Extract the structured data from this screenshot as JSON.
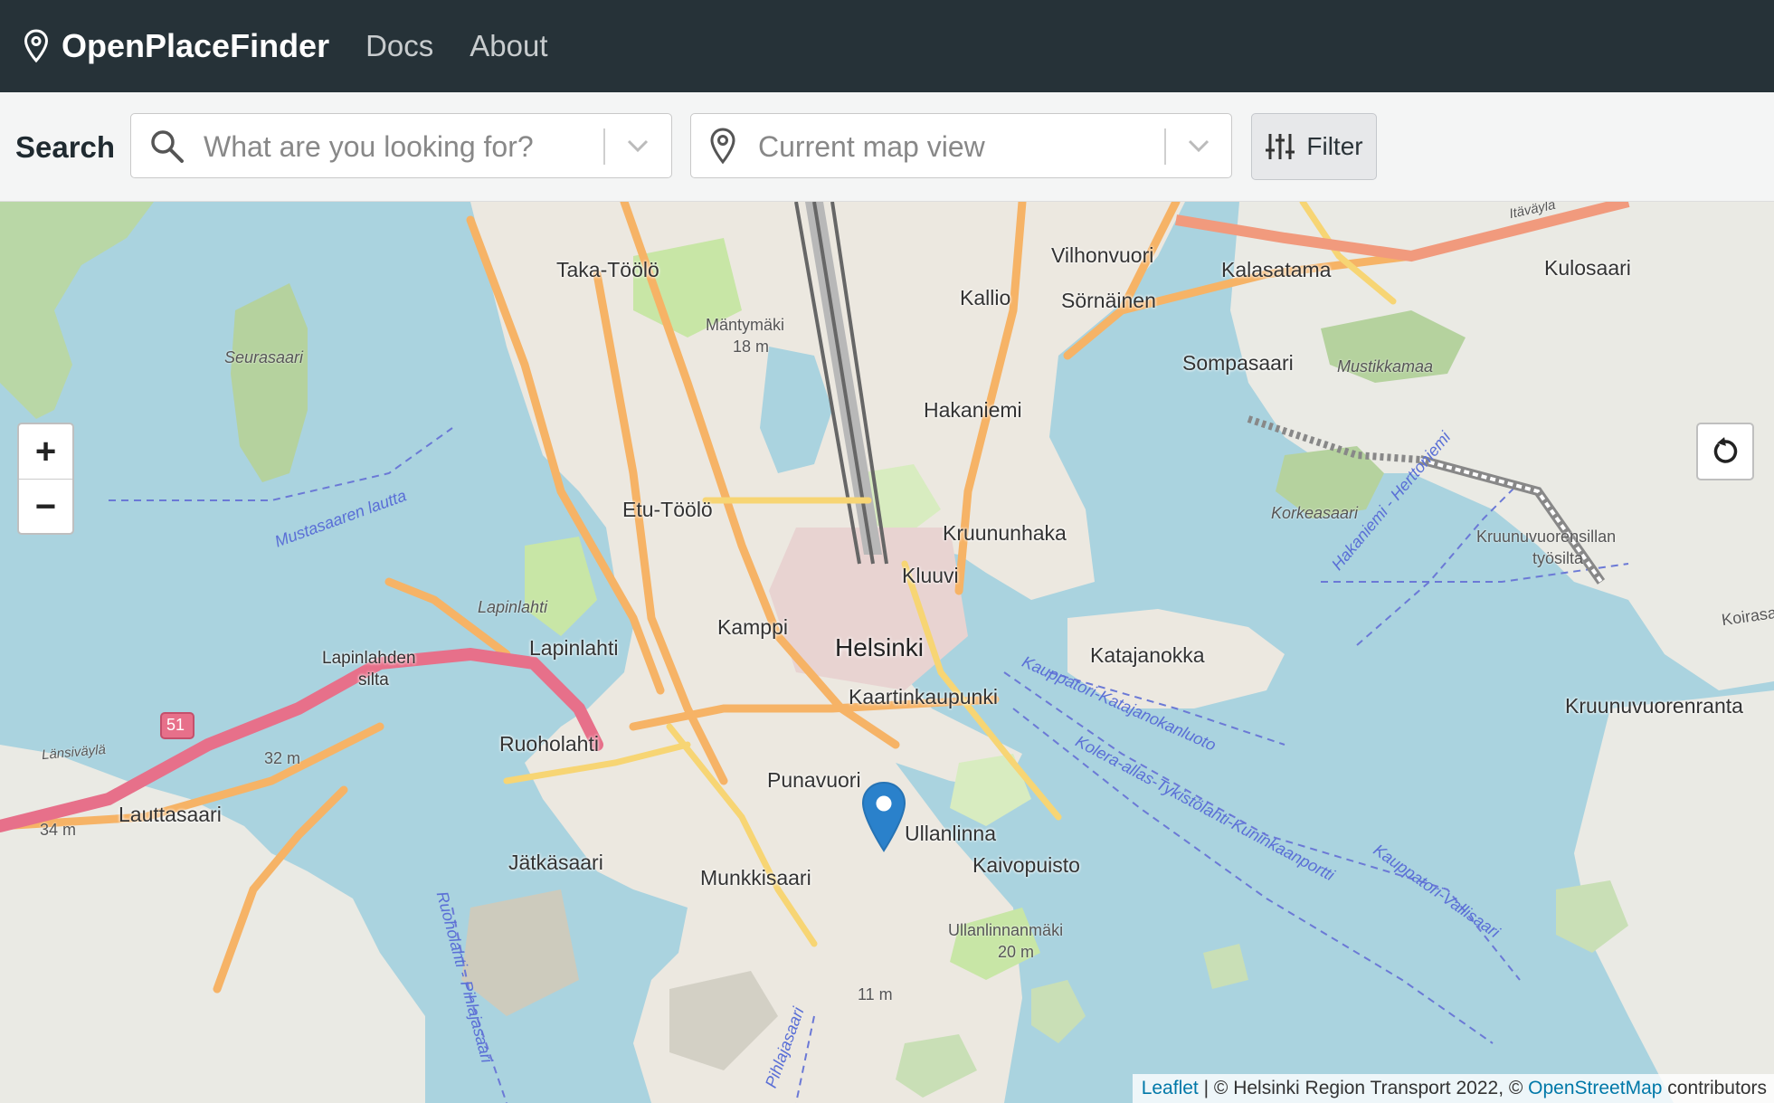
{
  "navbar": {
    "brand": "OpenPlaceFinder",
    "links": [
      "Docs",
      "About"
    ]
  },
  "search": {
    "label": "Search",
    "query_placeholder": "What are you looking for?",
    "location_placeholder": "Current map view",
    "filter_label": "Filter"
  },
  "map": {
    "zoom_in": "+",
    "zoom_out": "−",
    "labels": {
      "taka_toolo": "Taka-Töölö",
      "mantymaki": "Mäntymäki",
      "mantymaki_elev": "18 m",
      "vilhonvuori": "Vilhonvuori",
      "kallio": "Kallio",
      "sornainen": "Sörnäinen",
      "kalasatama": "Kalasatama",
      "kulosaari": "Kulosaari",
      "itavayla": "Itäväylä",
      "seurasaari": "Seurasaari",
      "sompasaari": "Sompasaari",
      "mustikkamaa": "Mustikkamaa",
      "hakaniemi": "Hakaniemi",
      "korkeasaari": "Korkeasaari",
      "etu_toolo": "Etu-Töölö",
      "kruununhaka": "Kruununhaka",
      "kruunuvuorensillan": "Kruunuvuorensillan",
      "tyosilta": "työsilta",
      "mustasaaren_lautta": "Mustasaaren lautta",
      "kluuvi": "Kluuvi",
      "hakaniemi_herttoniemi": "Hakaniemi - Herttoniemi",
      "lapinlahti_water": "Lapinlahti",
      "kamppi": "Kamppi",
      "helsinki": "Helsinki",
      "katajanokka": "Katajanokka",
      "koirasaari": "Koirasa",
      "lapinlahden": "Lapinlahden",
      "silta": "silta",
      "lapinlahti": "Lapinlahti",
      "kaartinkaupunki": "Kaartinkaupunki",
      "kauppatori_katajanokka": "Kauppatori-Katajanokanluoto",
      "kruunuvuorenranta": "Kruunuvuorenranta",
      "road_51": "51",
      "lansivayla": "Länsiväylä",
      "elev_32": "32 m",
      "ruoholahti": "Ruoholahti",
      "korea_allas": "Kolera-allas-Tykistölahti-Kuninkaanportti",
      "punavuori": "Punavuori",
      "lauttasaari": "Lauttasaari",
      "elev_34": "34 m",
      "ullanlinna": "Ullanlinna",
      "kauppatori_vallisaari": "Kauppatori-Vallisaari",
      "jatkasaari": "Jätkäsaari",
      "kaivopuisto": "Kaivopuisto",
      "munkkisaari": "Munkkisaari",
      "ruoholahti_pihlajasaari": "Ruoholahti - Pihlajasaari",
      "ullanlinnanmaki": "Ullanlinnanmäki",
      "elev_20": "20 m",
      "elev_11": "11 m",
      "pihlajasaari": "Pihlajasaari"
    }
  },
  "attribution": {
    "leaflet": "Leaflet",
    "sep": " | © Helsinki Region Transport 2022, © ",
    "osm": "OpenStreetMap",
    "tail": " contributors"
  },
  "colors": {
    "navbar": "#263238",
    "water": "#aad3df",
    "land": "#f2efe9",
    "park": "#c8e6a6",
    "road_major": "#f6b366",
    "motorway": "#e7708a",
    "marker": "#2a81cb",
    "link": "#0078a8"
  },
  "icons": [
    "map-pin-icon",
    "search-icon",
    "chevron-down-icon",
    "location-pin-icon",
    "sliders-icon",
    "reset-icon",
    "map-marker-icon"
  ]
}
